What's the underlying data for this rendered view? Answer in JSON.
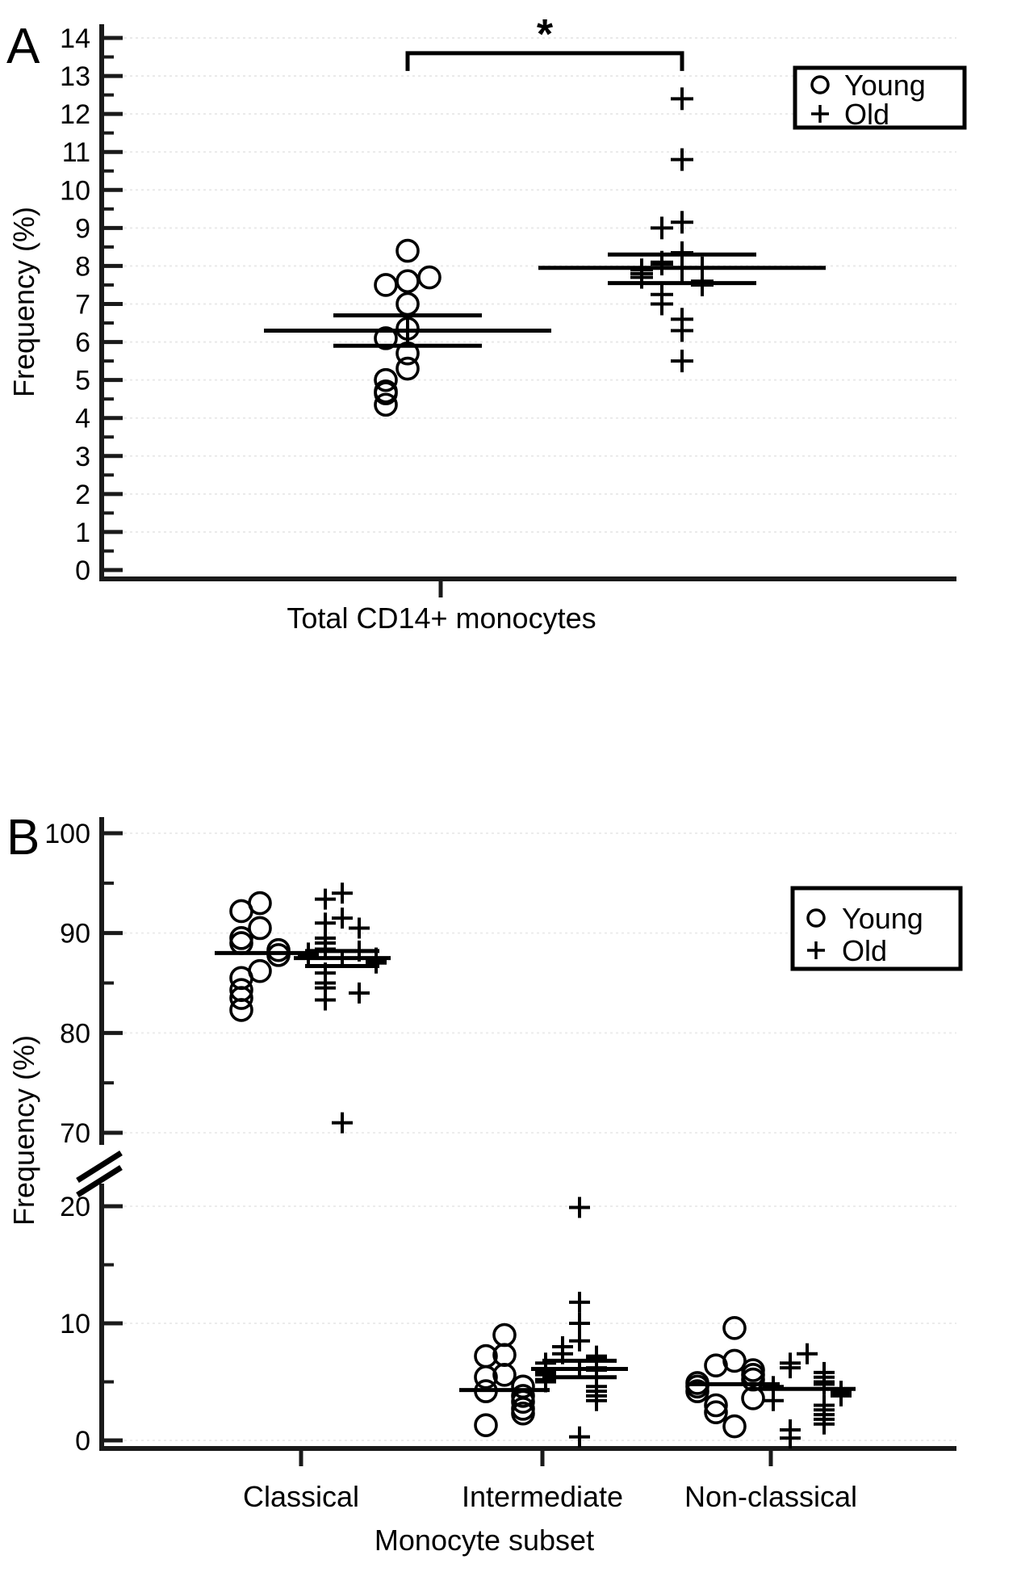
{
  "figure": {
    "panels": [
      "A",
      "B"
    ],
    "legend": {
      "young_label": "Young",
      "old_label": "Old",
      "young_marker": "circle-marker-icon",
      "old_marker": "plus-marker-icon"
    },
    "axis_titles": {
      "y": "Frequency (%)",
      "b_x": "Monocyte subset"
    }
  },
  "panel_a": {
    "letter": "A",
    "ylabel": "Frequency (%)",
    "xlabel": "Total CD14+ monocytes",
    "significance": "*",
    "ticks": [
      "0",
      "1",
      "2",
      "3",
      "4",
      "5",
      "6",
      "7",
      "8",
      "9",
      "10",
      "11",
      "12",
      "13",
      "14"
    ]
  },
  "panel_b": {
    "letter": "B",
    "ylabel": "Frequency (%)",
    "xlabel": "Monocyte subset",
    "upper_ticks": [
      "70",
      "80",
      "90",
      "100"
    ],
    "lower_ticks": [
      "0",
      "10",
      "20"
    ],
    "categories": [
      "Classical",
      "Intermediate",
      "Non-classical"
    ]
  },
  "chart_data": [
    {
      "type": "scatter",
      "title": "A",
      "xlabel": "Total CD14+ monocytes",
      "ylabel": "Frequency (%)",
      "ylim": [
        0,
        14
      ],
      "ytick_major": [
        0,
        1,
        2,
        3,
        4,
        5,
        6,
        7,
        8,
        9,
        10,
        11,
        12,
        13,
        14
      ],
      "ytick_minor": [
        0.5,
        1.5,
        2.5,
        3.5,
        4.5,
        5.5,
        6.5,
        7.5,
        8.5,
        9.5,
        10.5,
        11.5,
        12.5,
        13.5
      ],
      "grid": true,
      "legend": [
        "Young",
        "Old"
      ],
      "legend_position": "top-right",
      "annotations": [
        {
          "text": "*",
          "type": "significance-bracket",
          "groups": [
            "Young",
            "Old"
          ],
          "y": 13.6
        }
      ],
      "series": [
        {
          "name": "Young",
          "marker": "circle",
          "values": [
            8.4,
            7.6,
            7.5,
            7.7,
            7.0,
            6.35,
            6.1,
            5.7,
            5.3,
            5.0,
            4.7,
            4.65,
            4.35
          ],
          "mean": 6.3,
          "sem_upper": 6.7,
          "sem_lower": 5.9
        },
        {
          "name": "Old",
          "marker": "plus",
          "values": [
            12.4,
            10.8,
            9.15,
            9.0,
            8.35,
            8.1,
            8.05,
            7.95,
            7.9,
            7.8,
            7.7,
            7.6,
            7.5,
            7.25,
            7.0,
            6.6,
            6.3,
            5.5
          ],
          "mean": 7.95,
          "sem_upper": 8.3,
          "sem_lower": 7.55
        }
      ]
    },
    {
      "type": "scatter",
      "title": "B",
      "xlabel": "Monocyte subset",
      "ylabel": "Frequency (%)",
      "axis_break": {
        "lower_range": [
          0,
          20
        ],
        "upper_range": [
          70,
          100
        ]
      },
      "ytick_major_upper": [
        70,
        80,
        90,
        100
      ],
      "ytick_minor_upper": [
        75,
        85,
        95
      ],
      "ytick_major_lower": [
        0,
        10,
        20
      ],
      "ytick_minor_lower": [
        5,
        15
      ],
      "grid": true,
      "legend": [
        "Young",
        "Old"
      ],
      "legend_position": "right",
      "categories": [
        "Classical",
        "Intermediate",
        "Non-classical"
      ],
      "groups": [
        {
          "category": "Classical",
          "series": [
            {
              "name": "Young",
              "marker": "circle",
              "values": [
                93.0,
                92.2,
                90.5,
                89.5,
                89.0,
                88.3,
                87.8,
                86.2,
                85.5,
                84.3,
                83.5,
                82.3
              ],
              "mean": 88.0,
              "sem_upper": 88.0,
              "sem_lower": 88.0
            },
            {
              "name": "Old",
              "marker": "plus",
              "values": [
                94.0,
                93.4,
                91.5,
                91.0,
                90.5,
                89.5,
                89.0,
                88.4,
                88.2,
                88.0,
                87.8,
                87.5,
                87.3,
                87.0,
                86.0,
                85.0,
                84.5,
                84.0,
                83.3,
                71.0
              ],
              "mean": 87.5,
              "sem_upper": 88.2,
              "sem_lower": 86.7
            }
          ]
        },
        {
          "category": "Intermediate",
          "series": [
            {
              "name": "Young",
              "marker": "circle",
              "values": [
                9.0,
                7.3,
                7.2,
                5.6,
                5.4,
                4.6,
                4.2,
                3.8,
                3.3,
                2.7,
                2.3,
                1.3
              ],
              "mean": 4.3,
              "sem_upper": 4.3,
              "sem_lower": 4.3
            },
            {
              "name": "Old",
              "marker": "plus",
              "values": [
                19.9,
                11.8,
                10.0,
                8.5,
                8.0,
                7.4,
                7.2,
                7.0,
                6.6,
                6.2,
                6.0,
                5.8,
                5.6,
                5.2,
                5.0,
                4.6,
                4.2,
                3.8,
                3.4,
                0.3
              ],
              "mean": 6.1,
              "sem_upper": 6.8,
              "sem_lower": 5.4
            }
          ]
        },
        {
          "category": "Non-classical",
          "series": [
            {
              "name": "Young",
              "marker": "circle",
              "values": [
                9.6,
                6.8,
                6.4,
                6.0,
                5.6,
                5.2,
                4.9,
                4.6,
                4.2,
                3.6,
                3.0,
                2.4,
                1.2
              ],
              "mean": 4.8,
              "sem_upper": 4.8,
              "sem_lower": 4.8
            },
            {
              "name": "Old",
              "marker": "plus",
              "values": [
                7.4,
                6.6,
                6.2,
                5.8,
                5.4,
                5.0,
                4.8,
                4.6,
                4.4,
                4.2,
                4.0,
                3.8,
                3.4,
                3.0,
                2.6,
                2.2,
                1.8,
                1.4,
                0.9,
                0.2
              ],
              "mean": 4.4,
              "sem_upper": 4.4,
              "sem_lower": 4.4
            }
          ]
        }
      ]
    }
  ]
}
